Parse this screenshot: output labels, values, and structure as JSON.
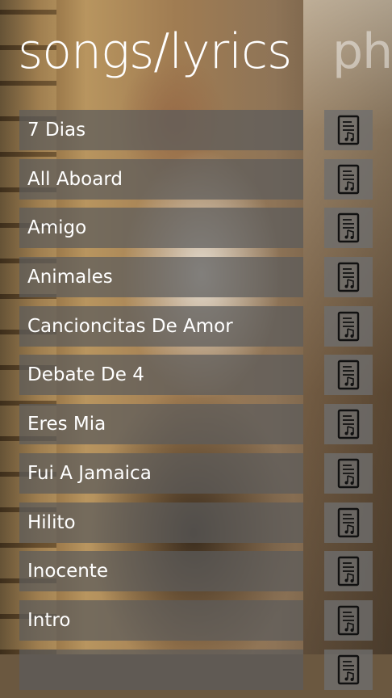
{
  "header": {
    "title": "songs/lyrics",
    "next_title": "ph"
  },
  "songs": [
    {
      "title": "7 Dias",
      "icon": "lyrics-sheet-icon"
    },
    {
      "title": "All Aboard",
      "icon": "lyrics-sheet-icon"
    },
    {
      "title": "Amigo",
      "icon": "lyrics-sheet-icon"
    },
    {
      "title": "Animales",
      "icon": "lyrics-sheet-icon"
    },
    {
      "title": "Cancioncitas De Amor",
      "icon": "lyrics-sheet-icon"
    },
    {
      "title": "Debate De 4",
      "icon": "lyrics-sheet-icon"
    },
    {
      "title": "Eres Mia",
      "icon": "lyrics-sheet-icon"
    },
    {
      "title": "Fui A Jamaica",
      "icon": "lyrics-sheet-icon"
    },
    {
      "title": "Hilito",
      "icon": "lyrics-sheet-icon"
    },
    {
      "title": "Inocente",
      "icon": "lyrics-sheet-icon"
    },
    {
      "title": "Intro",
      "icon": "lyrics-sheet-icon"
    },
    {
      "title": "",
      "icon": "lyrics-sheet-icon"
    }
  ],
  "colors": {
    "row_background": "#5c5c5c",
    "button_background": "#6e6e6e",
    "text": "#ffffff"
  }
}
